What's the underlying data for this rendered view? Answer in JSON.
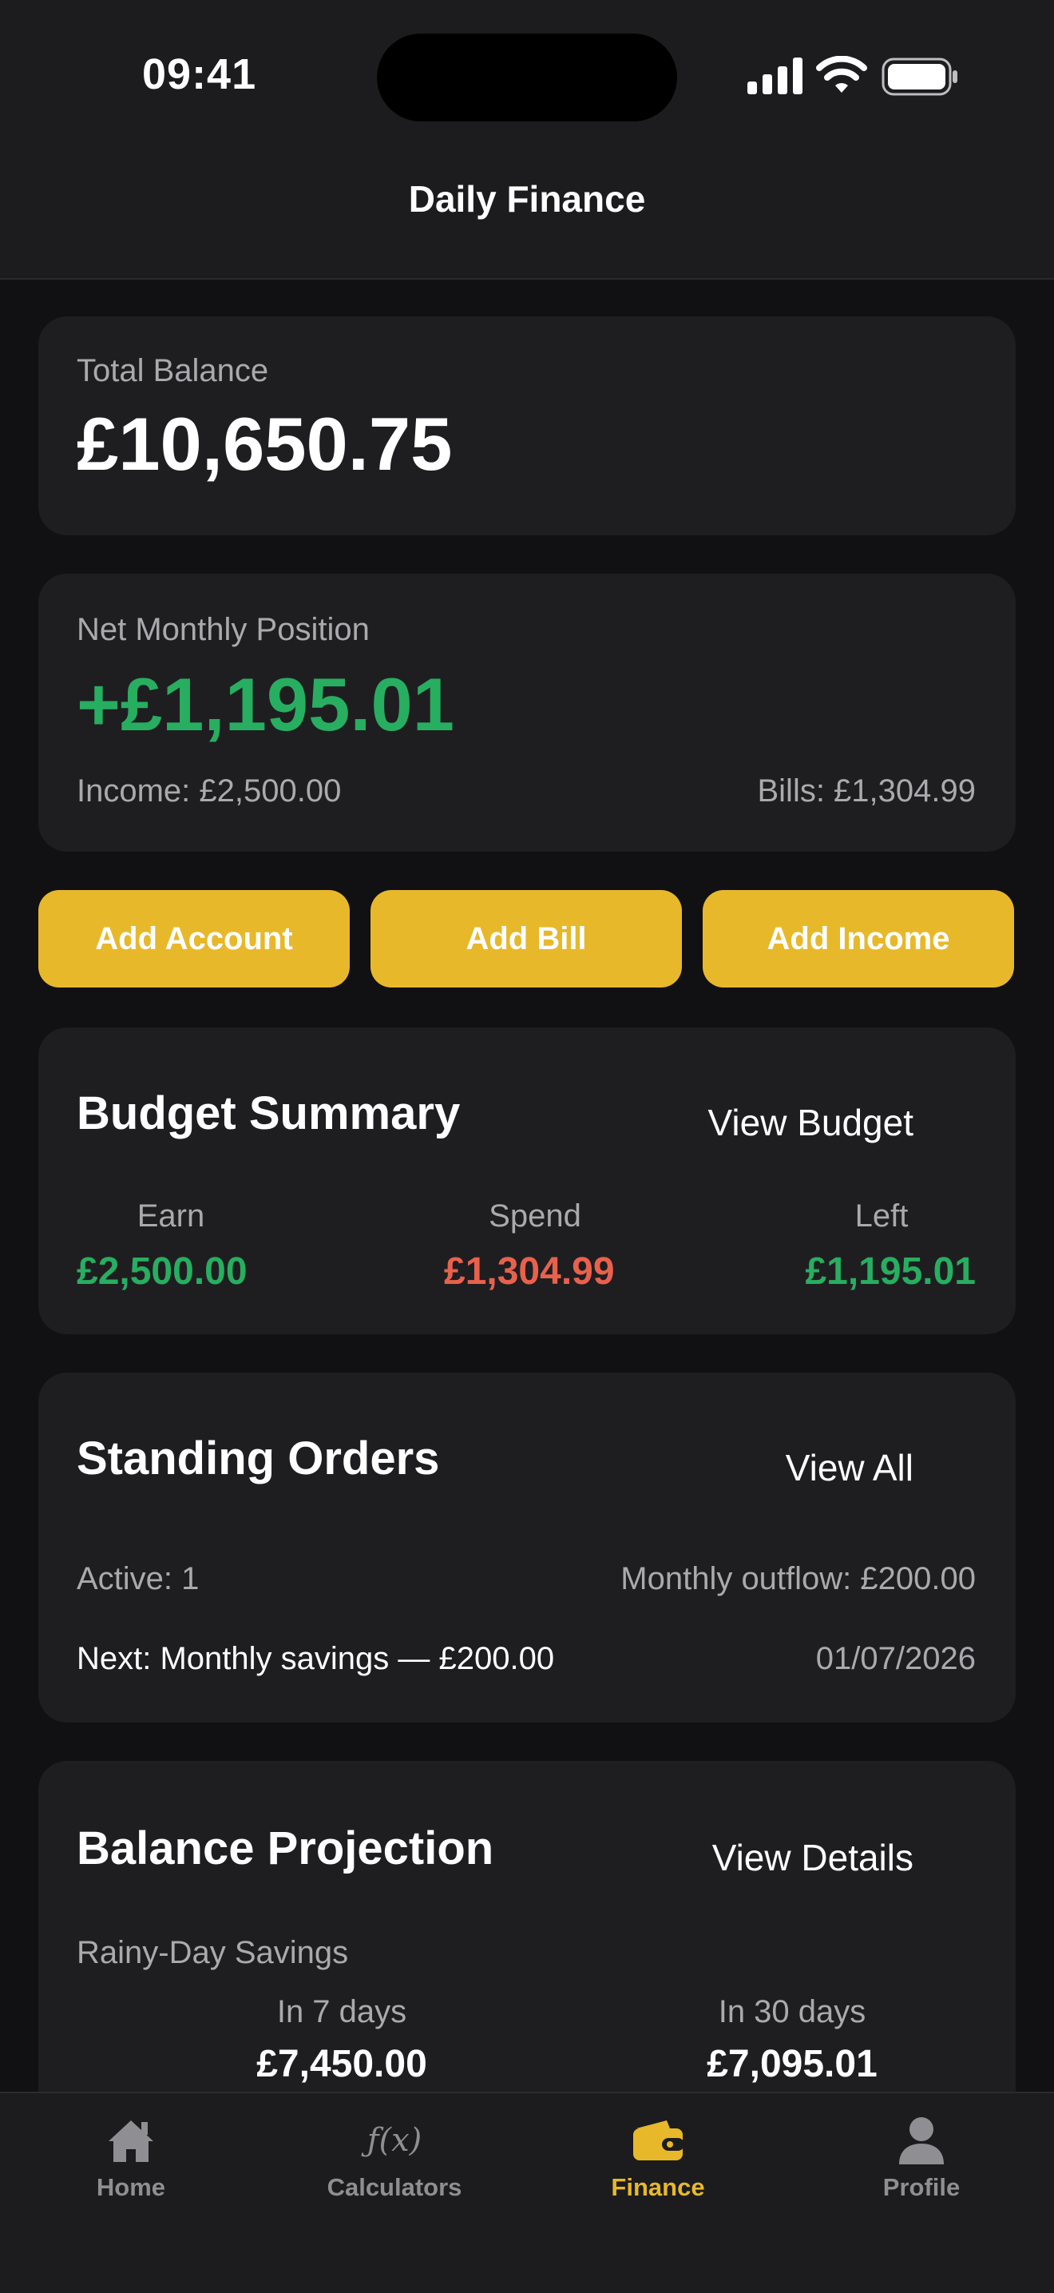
{
  "status_bar": {
    "time": "09:41"
  },
  "header": {
    "title": "Daily Finance"
  },
  "total_balance": {
    "label": "Total Balance",
    "value": "£10,650.75"
  },
  "net_monthly": {
    "label": "Net Monthly Position",
    "value": "+£1,195.01",
    "income": "Income: £2,500.00",
    "bills": "Bills: £1,304.99"
  },
  "actions": {
    "add_account": "Add Account",
    "add_bill": "Add Bill",
    "add_income": "Add Income"
  },
  "budget": {
    "title": "Budget Summary",
    "link": "View Budget",
    "earn_label": "Earn",
    "earn_value": "£2,500.00",
    "spend_label": "Spend",
    "spend_value": "£1,304.99",
    "left_label": "Left",
    "left_value": "£1,195.01"
  },
  "standing_orders": {
    "title": "Standing Orders",
    "link": "View All",
    "active": "Active: 1",
    "outflow": "Monthly outflow: £200.00",
    "next": "Next: Monthly savings — £200.00",
    "date": "01/07/2026"
  },
  "projection": {
    "title": "Balance Projection",
    "link": "View Details",
    "account": "Rainy-Day Savings",
    "d7_label": "In 7 days",
    "d7_value": "£7,450.00",
    "d30_label": "In 30 days",
    "d30_value": "£7,095.01"
  },
  "tabs": [
    {
      "label": "Home",
      "icon": "house-icon"
    },
    {
      "label": "Calculators",
      "icon": "function-icon",
      "glyph": "ƒ(x)"
    },
    {
      "label": "Finance",
      "icon": "wallet-icon"
    },
    {
      "label": "Profile",
      "icon": "person-icon"
    }
  ],
  "colors": {
    "accent": "#e8b82b",
    "positive": "#27ae60",
    "negative": "#e8614c",
    "card": "#1e1e21",
    "background": "#111113"
  }
}
